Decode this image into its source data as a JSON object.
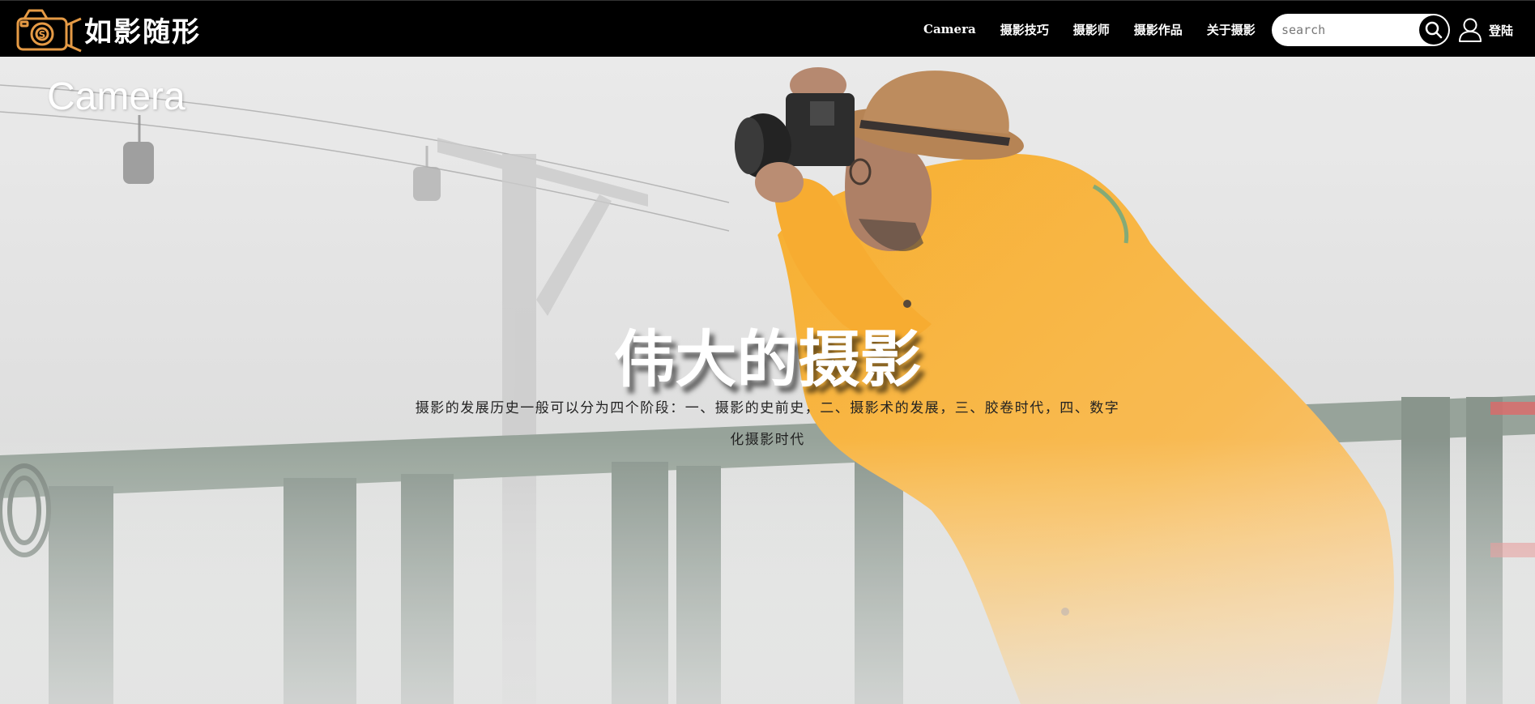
{
  "brand": {
    "name": "如影随形",
    "logo_icon": "camera-logo-icon",
    "accent_color": "#e59a45"
  },
  "nav": {
    "items": [
      {
        "label": "Camera"
      },
      {
        "label": "摄影技巧"
      },
      {
        "label": "摄影师"
      },
      {
        "label": "摄影作品"
      },
      {
        "label": "关于摄影"
      }
    ]
  },
  "search": {
    "placeholder": "search",
    "value": "",
    "button_icon": "search-icon"
  },
  "user": {
    "icon": "user-icon",
    "label": "登陆"
  },
  "hero": {
    "corner_title": "Camera",
    "heading": "伟大的摄影",
    "description": "摄影的发展历史一般可以分为四个阶段：一、摄影的史前史，二、摄影术的发展，三、胶卷时代，四、数字化摄影时代",
    "image_subject": "photographer in yellow raincoat with camera on foggy railing",
    "colors": {
      "fog": "#dcdcdc",
      "raincoat": "#f6ad2e",
      "hat": "#b07a47",
      "railing": "#8c9a90"
    }
  }
}
